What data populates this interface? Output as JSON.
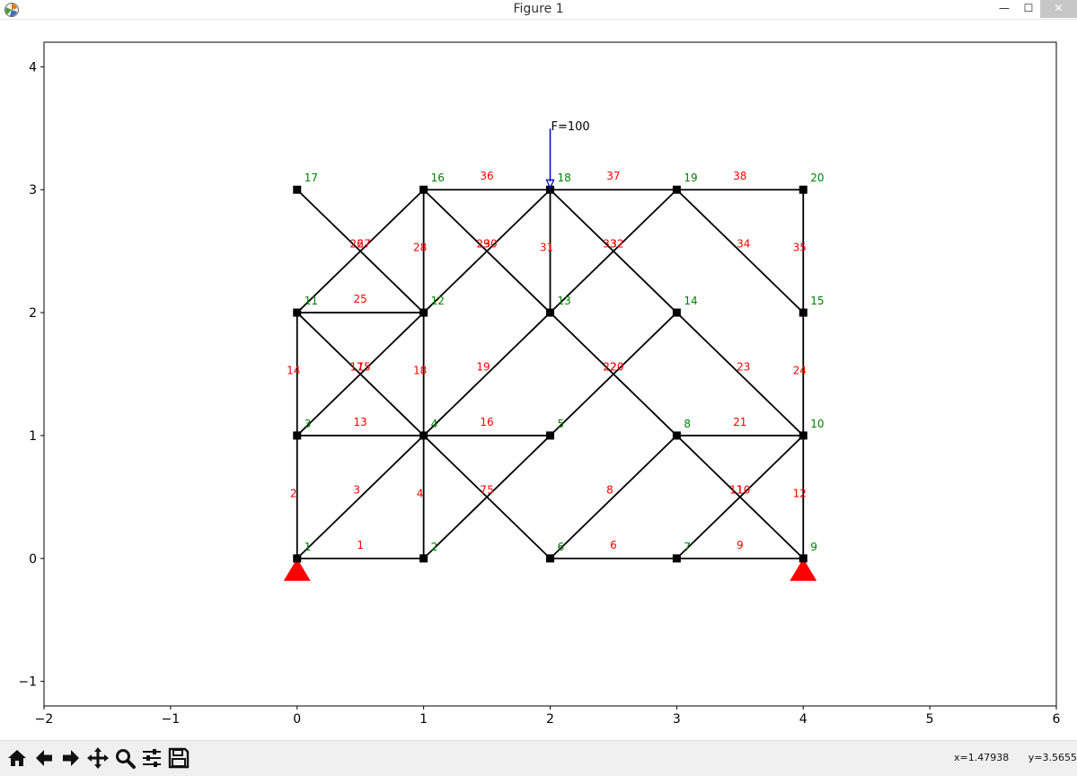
{
  "window": {
    "title": "Figure 1",
    "minimize": "—",
    "maximize": "☐",
    "close": "✕"
  },
  "toolbar": {
    "buttons": [
      {
        "name": "home-button",
        "icon": "home-icon"
      },
      {
        "name": "back-button",
        "icon": "arrow-left-icon"
      },
      {
        "name": "forward-button",
        "icon": "arrow-right-icon"
      },
      {
        "name": "pan-button",
        "icon": "move-icon"
      },
      {
        "name": "zoom-button",
        "icon": "magnifier-icon"
      },
      {
        "name": "configure-subplots-button",
        "icon": "sliders-icon"
      },
      {
        "name": "save-button",
        "icon": "floppy-disk-icon"
      }
    ],
    "x_readout": "x=1.47938",
    "y_readout": "y=3.5655"
  },
  "chart_data": {
    "type": "diagram",
    "xlim": [
      -2,
      6
    ],
    "ylim": [
      -1.2,
      4.2
    ],
    "xticks": [
      "−2",
      "−1",
      "0",
      "1",
      "2",
      "3",
      "4",
      "5",
      "6"
    ],
    "xtick_values": [
      -2,
      -1,
      0,
      1,
      2,
      3,
      4,
      5,
      6
    ],
    "yticks": [
      "−1",
      "0",
      "1",
      "2",
      "3",
      "4"
    ],
    "ytick_values": [
      -1,
      0,
      1,
      2,
      3,
      4
    ],
    "node_label_color": "#008000",
    "element_label_color": "#ff0000",
    "member_color": "#000000",
    "support_color": "#ff0000",
    "load_color": "#0000cc",
    "nodes": [
      {
        "id": "1",
        "x": 0,
        "y": 0
      },
      {
        "id": "2",
        "x": 1,
        "y": 0
      },
      {
        "id": "3",
        "x": 0,
        "y": 1
      },
      {
        "id": "4",
        "x": 1,
        "y": 1
      },
      {
        "id": "5",
        "x": 2,
        "y": 1
      },
      {
        "id": "6",
        "x": 2,
        "y": 0
      },
      {
        "id": "7",
        "x": 3,
        "y": 0
      },
      {
        "id": "8",
        "x": 3,
        "y": 1
      },
      {
        "id": "9",
        "x": 4,
        "y": 0
      },
      {
        "id": "10",
        "x": 4,
        "y": 1
      },
      {
        "id": "11",
        "x": 0,
        "y": 2
      },
      {
        "id": "12",
        "x": 1,
        "y": 2
      },
      {
        "id": "13",
        "x": 2,
        "y": 2
      },
      {
        "id": "14",
        "x": 3,
        "y": 2
      },
      {
        "id": "15",
        "x": 4,
        "y": 2
      },
      {
        "id": "16",
        "x": 1,
        "y": 3
      },
      {
        "id": "17",
        "x": 0,
        "y": 3
      },
      {
        "id": "18",
        "x": 2,
        "y": 3
      },
      {
        "id": "19",
        "x": 3,
        "y": 3
      },
      {
        "id": "20",
        "x": 4,
        "y": 3
      }
    ],
    "members": [
      {
        "id": "1",
        "from": "1",
        "to": "2"
      },
      {
        "id": "2",
        "from": "1",
        "to": "3"
      },
      {
        "id": "3",
        "from": "1",
        "to": "4"
      },
      {
        "id": "4",
        "from": "2",
        "to": "4"
      },
      {
        "id": "5",
        "from": "4",
        "to": "6"
      },
      {
        "id": "6",
        "from": "6",
        "to": "7"
      },
      {
        "id": "7",
        "from": "2",
        "to": "5"
      },
      {
        "id": "8",
        "from": "6",
        "to": "8"
      },
      {
        "id": "9",
        "from": "7",
        "to": "9"
      },
      {
        "id": "10",
        "from": "8",
        "to": "9"
      },
      {
        "id": "11",
        "from": "7",
        "to": "10"
      },
      {
        "id": "12",
        "from": "9",
        "to": "10"
      },
      {
        "id": "13",
        "from": "3",
        "to": "4"
      },
      {
        "id": "14",
        "from": "3",
        "to": "11"
      },
      {
        "id": "15",
        "from": "11",
        "to": "4"
      },
      {
        "id": "16",
        "from": "4",
        "to": "5"
      },
      {
        "id": "17",
        "from": "3",
        "to": "12"
      },
      {
        "id": "18",
        "from": "4",
        "to": "12"
      },
      {
        "id": "19",
        "from": "4",
        "to": "13"
      },
      {
        "id": "20",
        "from": "13",
        "to": "8"
      },
      {
        "id": "21",
        "from": "8",
        "to": "10"
      },
      {
        "id": "22",
        "from": "5",
        "to": "14"
      },
      {
        "id": "23",
        "from": "14",
        "to": "10"
      },
      {
        "id": "24",
        "from": "10",
        "to": "15"
      },
      {
        "id": "25",
        "from": "11",
        "to": "12"
      },
      {
        "id": "26",
        "from": "11",
        "to": "16"
      },
      {
        "id": "27",
        "from": "17",
        "to": "12"
      },
      {
        "id": "28",
        "from": "12",
        "to": "16"
      },
      {
        "id": "29",
        "from": "12",
        "to": "18"
      },
      {
        "id": "30",
        "from": "16",
        "to": "13"
      },
      {
        "id": "31",
        "from": "13",
        "to": "18"
      },
      {
        "id": "32",
        "from": "18",
        "to": "14"
      },
      {
        "id": "33",
        "from": "13",
        "to": "19"
      },
      {
        "id": "34",
        "from": "19",
        "to": "15"
      },
      {
        "id": "35",
        "from": "15",
        "to": "20"
      },
      {
        "id": "36",
        "from": "16",
        "to": "18"
      },
      {
        "id": "37",
        "from": "18",
        "to": "19"
      },
      {
        "id": "38",
        "from": "19",
        "to": "20"
      }
    ],
    "supports": [
      "1",
      "9"
    ],
    "load": {
      "node": "18",
      "label": "F=100",
      "direction": "down"
    }
  }
}
